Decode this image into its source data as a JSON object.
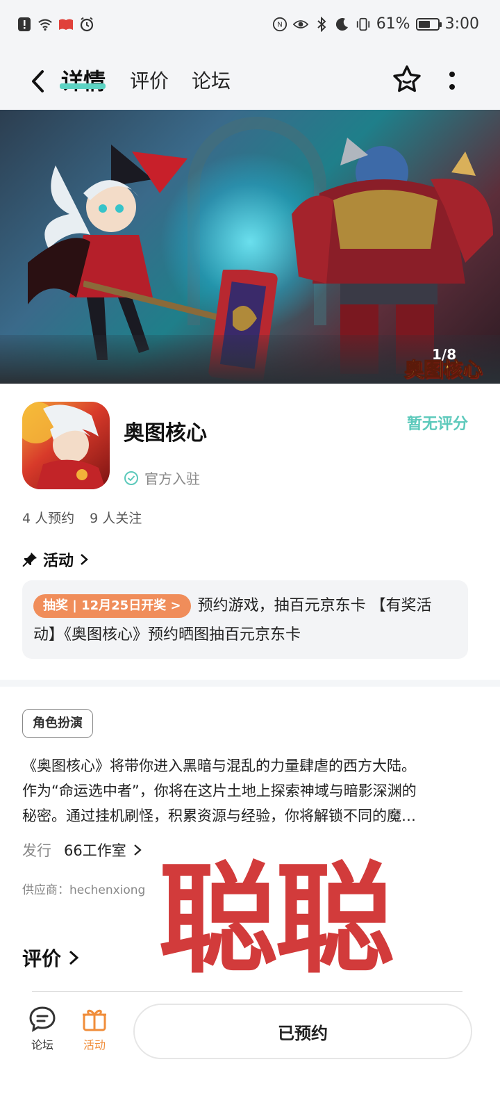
{
  "status_bar": {
    "battery_percent": "61%",
    "battery_level": 0.61,
    "time": "3:00"
  },
  "nav": {
    "tabs": [
      {
        "label": "详情",
        "active": true
      },
      {
        "label": "评价",
        "active": false
      },
      {
        "label": "论坛",
        "active": false
      }
    ]
  },
  "banner": {
    "counter": "1/8",
    "logo_text": "奥图核心"
  },
  "app": {
    "name": "奥图核心",
    "rating": "暂无评分",
    "official": "官方入驻",
    "reservations": "4 人预约",
    "followers": "9 人关注"
  },
  "activity": {
    "heading": "活动",
    "badge": "抽奖 | 12月25日开奖 >",
    "text_line1": "预约游戏，抽百元京东卡 【有奖活",
    "text_line2": "动】《奥图核心》预约晒图抽百元京东卡"
  },
  "details": {
    "genre": "角色扮演",
    "description_lines": [
      "《奥图核心》将带你进入黑暗与混乱的力量肆虐的西方大陆。",
      "作为“命运选中者”，你将在这片土地上探索神域与暗影深渊的",
      "秘密。通过挂机刷怪，积累资源与经验，你将解锁不同的魔…"
    ],
    "publisher_label": "发行",
    "publisher": "66工作室",
    "supplier": "供应商：hechenxiong"
  },
  "watermark": "聪聪",
  "reviews": {
    "heading": "评价"
  },
  "bottom_bar": {
    "forum_label": "论坛",
    "activity_label": "活动",
    "reserve_label": "已预约"
  },
  "colors": {
    "accent": "#5cd3c3",
    "rating": "#5cc9bb",
    "lottery_badge": "#f08d5a",
    "activity_tab": "#f08d3a",
    "watermark": "#d23b3b"
  }
}
